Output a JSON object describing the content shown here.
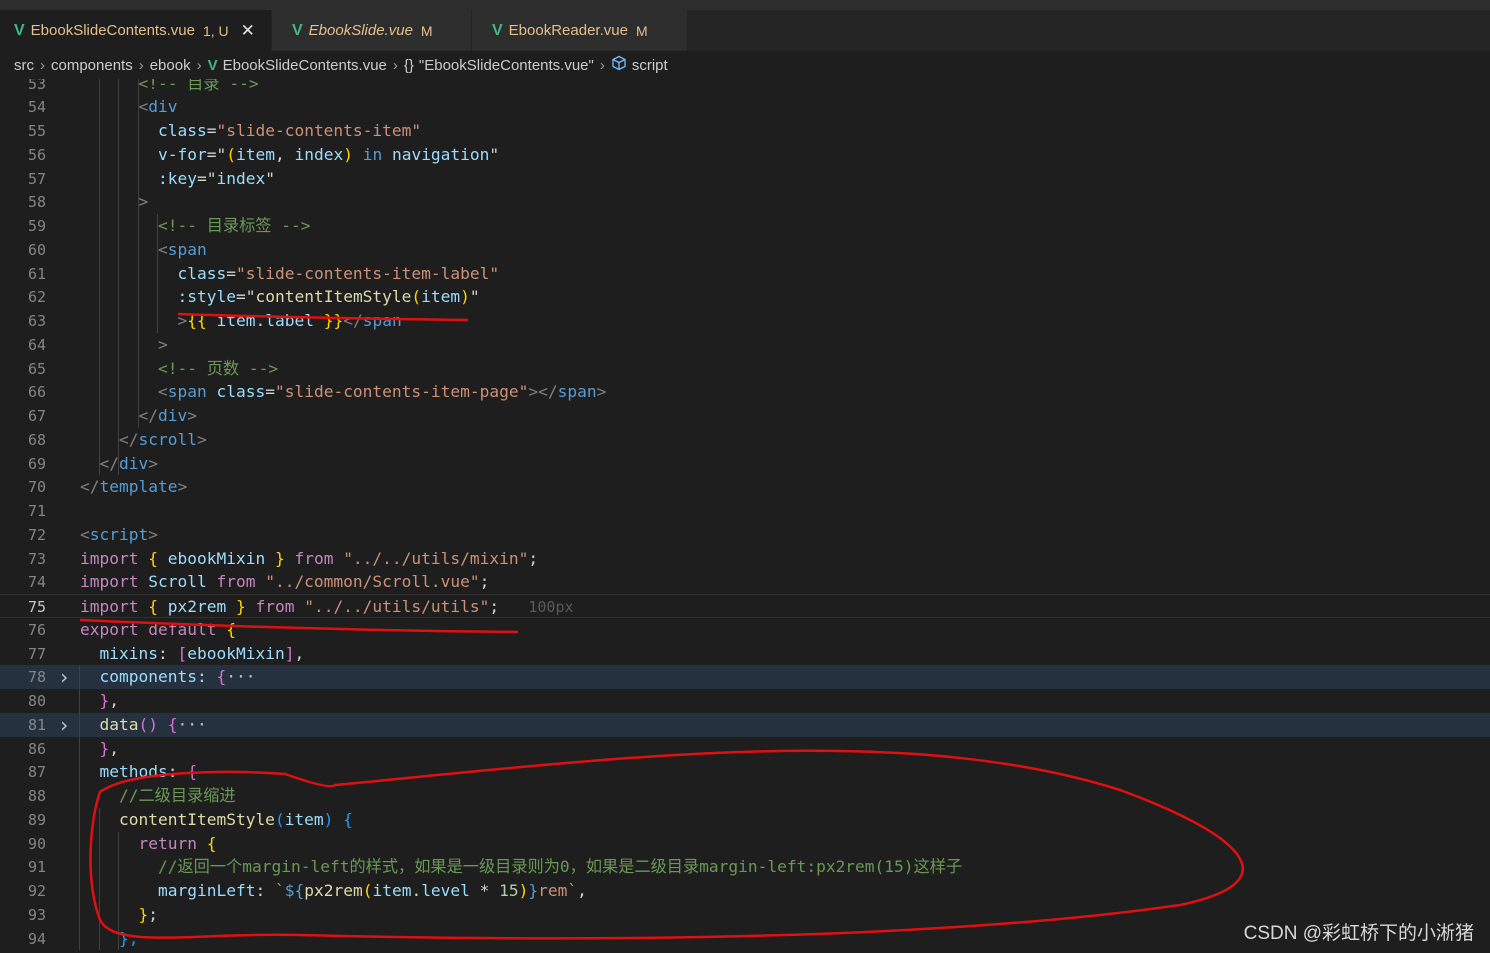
{
  "tabs": [
    {
      "label": "EbookSlideContents.vue",
      "status": "1, U",
      "close": "✕",
      "active": true
    },
    {
      "label": "EbookSlide.vue",
      "status": "M",
      "active": false
    },
    {
      "label": "EbookReader.vue",
      "status": "M",
      "active": false
    }
  ],
  "breadcrumb": {
    "parts": [
      "src",
      "components",
      "ebook",
      "EbookSlideContents.vue",
      "\"EbookSlideContents.vue\"",
      "script"
    ],
    "separator": "›"
  },
  "icons": {
    "vue": "vue-icon",
    "braces": "braces-icon",
    "script": "cube-icon",
    "fold": "chevron-right-icon"
  },
  "colors": {
    "background": "#1e1e1e",
    "keyword": "#c586c0",
    "string": "#ce9178",
    "comment": "#6a9955",
    "annotation": "#e01010"
  },
  "lines": [
    {
      "n": "53",
      "t": [
        [
          "t-com",
          "<!-- 目录 -->"
        ]
      ]
    },
    {
      "n": "54",
      "t": [
        [
          "t-punc",
          "<"
        ],
        [
          "t-tag",
          "div"
        ]
      ]
    },
    {
      "n": "55",
      "t": [
        [
          "t-attr",
          "class"
        ],
        [
          "",
          "="
        ],
        [
          "t-str",
          "\"slide-contents-item\""
        ]
      ]
    },
    {
      "n": "56",
      "t": [
        [
          "t-attr",
          "v-for"
        ],
        [
          "",
          "=\""
        ],
        [
          "t-y",
          "("
        ],
        [
          "t-var",
          "item"
        ],
        [
          "",
          ", "
        ],
        [
          "t-var",
          "index"
        ],
        [
          "t-y",
          ")"
        ],
        [
          "",
          " "
        ],
        [
          "t-blue",
          "in"
        ],
        [
          "",
          " "
        ],
        [
          "t-var",
          "navigation"
        ],
        [
          "",
          "\""
        ]
      ]
    },
    {
      "n": "57",
      "t": [
        [
          "t-attr",
          ":key"
        ],
        [
          "",
          "=\""
        ],
        [
          "t-var",
          "index"
        ],
        [
          "",
          "\""
        ]
      ]
    },
    {
      "n": "58",
      "t": [
        [
          "t-punc",
          ">"
        ]
      ]
    },
    {
      "n": "59",
      "t": [
        [
          "t-com",
          "<!-- 目录标签 -->"
        ]
      ]
    },
    {
      "n": "60",
      "t": [
        [
          "t-punc",
          "<"
        ],
        [
          "t-tag",
          "span"
        ]
      ]
    },
    {
      "n": "61",
      "t": [
        [
          "t-attr",
          "class"
        ],
        [
          "",
          "="
        ],
        [
          "t-str",
          "\"slide-contents-item-label\""
        ]
      ]
    },
    {
      "n": "62",
      "t": [
        [
          "t-attr",
          ":style"
        ],
        [
          "",
          "=\""
        ],
        [
          "t-fn",
          "contentItemStyle"
        ],
        [
          "t-y",
          "("
        ],
        [
          "t-var",
          "item"
        ],
        [
          "t-y",
          ")"
        ],
        [
          "",
          "\""
        ]
      ]
    },
    {
      "n": "63",
      "t": [
        [
          "t-punc",
          ">"
        ],
        [
          "t-y",
          "{{"
        ],
        [
          "",
          " "
        ],
        [
          "t-var",
          "item"
        ],
        [
          "",
          "."
        ],
        [
          "t-var",
          "label"
        ],
        [
          "",
          " "
        ],
        [
          "t-y",
          "}}"
        ],
        [
          "t-punc",
          "</"
        ],
        [
          "t-tag",
          "span"
        ]
      ]
    },
    {
      "n": "64",
      "t": [
        [
          "t-punc",
          ">"
        ]
      ]
    },
    {
      "n": "65",
      "t": [
        [
          "t-com",
          "<!-- 页数 -->"
        ]
      ]
    },
    {
      "n": "66",
      "t": [
        [
          "t-punc",
          "<"
        ],
        [
          "t-tag",
          "span"
        ],
        [
          "",
          " "
        ],
        [
          "t-attr",
          "class"
        ],
        [
          "",
          "="
        ],
        [
          "t-str",
          "\"slide-contents-item-page\""
        ],
        [
          "t-punc",
          "></"
        ],
        [
          "t-tag",
          "span"
        ],
        [
          "t-punc",
          ">"
        ]
      ]
    },
    {
      "n": "67",
      "t": [
        [
          "t-punc",
          "</"
        ],
        [
          "t-tag",
          "div"
        ],
        [
          "t-punc",
          ">"
        ]
      ]
    },
    {
      "n": "68",
      "t": [
        [
          "t-punc",
          "</"
        ],
        [
          "t-tag",
          "scroll"
        ],
        [
          "t-punc",
          ">"
        ]
      ]
    },
    {
      "n": "69",
      "t": [
        [
          "t-punc",
          "</"
        ],
        [
          "t-tag",
          "div"
        ],
        [
          "t-punc",
          ">"
        ]
      ]
    },
    {
      "n": "70",
      "t": [
        [
          "t-punc",
          "</"
        ],
        [
          "t-tag",
          "template"
        ],
        [
          "t-punc",
          ">"
        ]
      ]
    },
    {
      "n": "71",
      "t": []
    },
    {
      "n": "72",
      "t": [
        [
          "t-punc",
          "<"
        ],
        [
          "t-tag",
          "script"
        ],
        [
          "t-punc",
          ">"
        ]
      ]
    },
    {
      "n": "73",
      "t": [
        [
          "t-kw",
          "import"
        ],
        [
          "",
          " "
        ],
        [
          "t-y",
          "{"
        ],
        [
          "",
          " "
        ],
        [
          "t-var",
          "ebookMixin"
        ],
        [
          "",
          " "
        ],
        [
          "t-y",
          "}"
        ],
        [
          "",
          " "
        ],
        [
          "t-kw",
          "from"
        ],
        [
          "",
          " "
        ],
        [
          "t-str",
          "\"../../utils/mixin\""
        ],
        [
          "",
          ";"
        ]
      ]
    },
    {
      "n": "74",
      "t": [
        [
          "t-kw",
          "import"
        ],
        [
          "",
          " "
        ],
        [
          "t-var",
          "Scroll"
        ],
        [
          "",
          " "
        ],
        [
          "t-kw",
          "from"
        ],
        [
          "",
          " "
        ],
        [
          "t-str",
          "\"../common/Scroll.vue\""
        ],
        [
          "",
          ";"
        ]
      ]
    },
    {
      "n": "75",
      "t": [
        [
          "t-kw",
          "import"
        ],
        [
          "",
          " "
        ],
        [
          "t-y",
          "{"
        ],
        [
          "",
          " "
        ],
        [
          "t-var",
          "px2rem"
        ],
        [
          "",
          " "
        ],
        [
          "t-y",
          "}"
        ],
        [
          "",
          " "
        ],
        [
          "t-kw",
          "from"
        ],
        [
          "",
          " "
        ],
        [
          "t-str",
          "\"../../utils/utils\""
        ],
        [
          "",
          ";"
        ],
        [
          "",
          "   "
        ],
        [
          "t-hint",
          "100px"
        ]
      ]
    },
    {
      "n": "76",
      "t": [
        [
          "t-kw",
          "export"
        ],
        [
          "",
          " "
        ],
        [
          "t-kw",
          "default"
        ],
        [
          "",
          " "
        ],
        [
          "t-y",
          "{"
        ]
      ]
    },
    {
      "n": "77",
      "t": [
        [
          "t-var",
          "mixins"
        ],
        [
          "",
          ": "
        ],
        [
          "t-p",
          "["
        ],
        [
          "t-var",
          "ebookMixin"
        ],
        [
          "t-p",
          "]"
        ],
        [
          "",
          ","
        ]
      ]
    },
    {
      "n": "78",
      "t": [
        [
          "t-var",
          "components"
        ],
        [
          "",
          ": "
        ],
        [
          "t-p",
          "{"
        ],
        [
          "t-dots",
          "···"
        ]
      ]
    },
    {
      "n": "80",
      "t": [
        [
          "t-p",
          "}"
        ],
        [
          "",
          ","
        ]
      ]
    },
    {
      "n": "81",
      "t": [
        [
          "t-fn",
          "data"
        ],
        [
          "t-p",
          "()"
        ],
        [
          "",
          " "
        ],
        [
          "t-p",
          "{"
        ],
        [
          "t-dots",
          "···"
        ]
      ]
    },
    {
      "n": "86",
      "t": [
        [
          "t-p",
          "}"
        ],
        [
          "",
          ","
        ]
      ]
    },
    {
      "n": "87",
      "t": [
        [
          "t-var",
          "methods"
        ],
        [
          "",
          ": "
        ],
        [
          "t-p",
          "{"
        ]
      ]
    },
    {
      "n": "88",
      "t": [
        [
          "t-com",
          "//二级目录缩进"
        ]
      ]
    },
    {
      "n": "89",
      "t": [
        [
          "t-fn",
          "contentItemStyle"
        ],
        [
          "t-b",
          "("
        ],
        [
          "t-var",
          "item"
        ],
        [
          "t-b",
          ")"
        ],
        [
          "",
          " "
        ],
        [
          "t-b",
          "{"
        ]
      ]
    },
    {
      "n": "90",
      "t": [
        [
          "t-kw",
          "return"
        ],
        [
          "",
          " "
        ],
        [
          "t-y",
          "{"
        ]
      ]
    },
    {
      "n": "91",
      "t": [
        [
          "t-com",
          "//返回一个margin-left的样式，如果是一级目录则为0，如果是二级目录margin-left:px2rem(15)这样子"
        ]
      ]
    },
    {
      "n": "92",
      "t": [
        [
          "t-var",
          "marginLeft"
        ],
        [
          "",
          ": "
        ],
        [
          "t-str",
          "`"
        ],
        [
          "t-blue",
          "${"
        ],
        [
          "t-fn",
          "px2rem"
        ],
        [
          "t-y",
          "("
        ],
        [
          "t-var",
          "item"
        ],
        [
          "",
          "."
        ],
        [
          "t-var",
          "level"
        ],
        [
          "",
          " * "
        ],
        [
          "t-num",
          "15"
        ],
        [
          "t-y",
          ")"
        ],
        [
          "t-blue",
          "}"
        ],
        [
          "t-str",
          "rem`"
        ],
        [
          "",
          ","
        ]
      ]
    },
    {
      "n": "93",
      "t": [
        [
          "t-y",
          "}"
        ],
        [
          "",
          ";"
        ]
      ]
    },
    {
      "n": "94",
      "t": [
        [
          "t-b",
          "},"
        ]
      ]
    }
  ],
  "watermark": "CSDN @彩虹桥下的小淅猪"
}
